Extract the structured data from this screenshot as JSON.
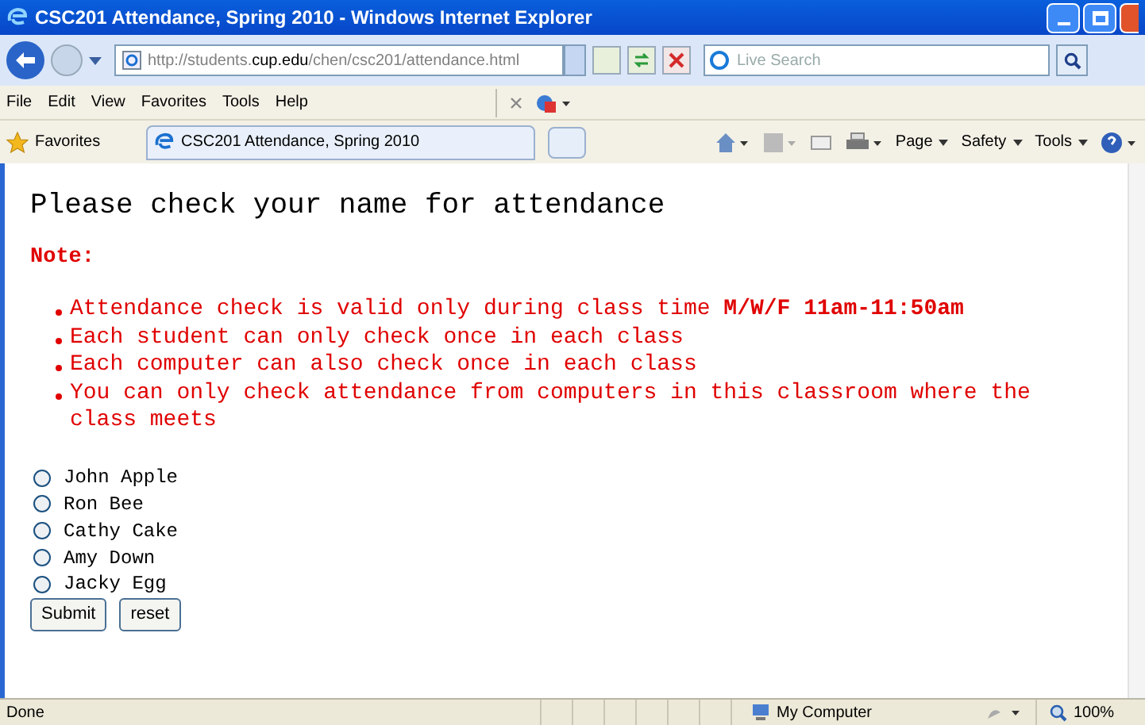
{
  "window": {
    "title": "CSC201 Attendance, Spring 2010 - Windows Internet Explorer"
  },
  "address_bar": {
    "url": [
      {
        "text": "http://students.",
        "dim": true
      },
      {
        "text": "cup.edu",
        "dim": false
      },
      {
        "text": "/chen/csc201/attendance.html",
        "dim": true
      }
    ],
    "search_placeholder": "Live Search"
  },
  "menu": [
    "File",
    "Edit",
    "View",
    "Favorites",
    "Tools",
    "Help"
  ],
  "favorites_bar": {
    "favorites": "Favorites",
    "tab": "CSC201 Attendance, Spring 2010",
    "commands": [
      "Page",
      "Safety",
      "Tools"
    ]
  },
  "page": {
    "heading": "Please check your name for attendance",
    "note_label": "Note:",
    "notes": [
      "Attendance check is valid only during class time **M/W/F 11am-11:50am**",
      "Each student can only check once in each class",
      "Each computer can also check once in each class",
      "You can only check attendance from computers in this classroom where the class meets"
    ],
    "students": [
      {
        "name": "John Apple",
        "selected": false
      },
      {
        "name": "Ron Bee",
        "selected": false
      },
      {
        "name": "Cathy Cake",
        "selected": false
      },
      {
        "name": "Amy Down",
        "selected": false
      },
      {
        "name": "Jacky Egg",
        "selected": false
      }
    ],
    "buttons": [
      "Submit",
      "reset"
    ]
  },
  "status_bar": {
    "status": "Done",
    "zone": "My Computer",
    "zoom": "100%"
  }
}
